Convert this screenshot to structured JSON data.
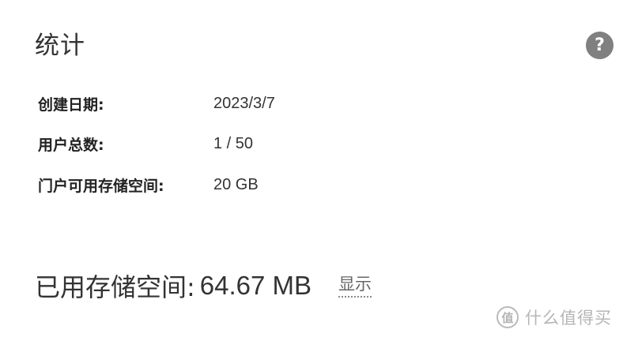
{
  "header": {
    "title": "统计",
    "help_icon": "question-mark-icon",
    "help_glyph": "?"
  },
  "stats": {
    "rows": [
      {
        "label": "创建日期:",
        "value": "2023/3/7"
      },
      {
        "label": "用户总数:",
        "value": "1 / 50"
      },
      {
        "label": "门户可用存储空间:",
        "value": "20 GB"
      }
    ]
  },
  "usage": {
    "label": "已用存储空间:",
    "value": "64.67 MB",
    "show_link": "显示"
  },
  "watermark": {
    "icon": "smzdm-logo-icon",
    "icon_glyph": "值",
    "text": "什么值得买"
  },
  "colors": {
    "help_icon_bg": "#808080",
    "text": "#333333"
  }
}
